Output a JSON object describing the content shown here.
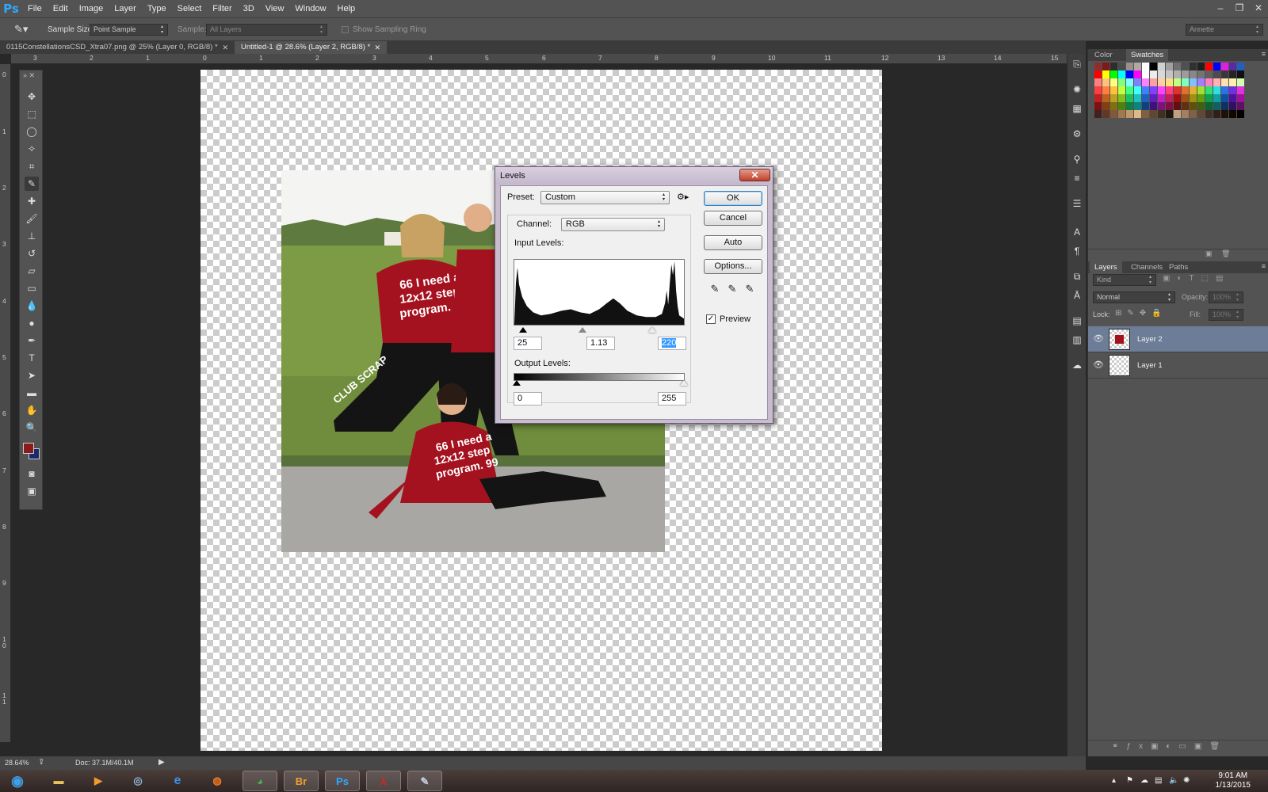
{
  "menubar": {
    "logo": "Ps",
    "items": [
      "File",
      "Edit",
      "Image",
      "Layer",
      "Type",
      "Select",
      "Filter",
      "3D",
      "View",
      "Window",
      "Help"
    ],
    "window_controls": [
      "–",
      "❐",
      "✕"
    ]
  },
  "options": {
    "sample_size_label": "Sample Size:",
    "sample_size_value": "Point Sample",
    "sample_label": "Sample:",
    "sample_value": "All Layers",
    "sampling_ring_label": "Show Sampling Ring",
    "workspace": "Annette"
  },
  "tabs": [
    {
      "title": "0115ConstellationsCSD_Xtra07.png @ 25% (Layer 0, RGB/8) *",
      "active": false
    },
    {
      "title": "Untitled-1 @ 28.6% (Layer 2, RGB/8) *",
      "active": true
    }
  ],
  "ruler": {
    "top_labels": [
      "3",
      "2",
      "1",
      "0",
      "1",
      "2",
      "3",
      "4",
      "5",
      "6",
      "7",
      "8",
      "9",
      "10",
      "11",
      "12",
      "13",
      "14",
      "15"
    ],
    "left_labels": [
      "0",
      "1",
      "2",
      "3",
      "4",
      "5",
      "6",
      "7",
      "8",
      "9",
      "1 0",
      "1 1"
    ]
  },
  "status": {
    "zoom": "28.64%",
    "doc": "Doc: 37.1M/40.1M"
  },
  "panels": {
    "top_tabs": [
      "Color",
      "Swatches"
    ],
    "layers_tabs": [
      "Layers",
      "Channels",
      "Paths"
    ],
    "kind_filter": "Kind",
    "blend_mode": "Normal",
    "opacity_label": "Opacity:",
    "opacity_value": "100%",
    "lock_label": "Lock:",
    "fill_label": "Fill:",
    "fill_value": "100%",
    "layers": [
      {
        "name": "Layer 2",
        "selected": true
      },
      {
        "name": "Layer 1",
        "selected": false
      }
    ]
  },
  "levels": {
    "title": "Levels",
    "preset_label": "Preset:",
    "preset_value": "Custom",
    "channel_label": "Channel:",
    "channel_value": "RGB",
    "input_levels_label": "Input Levels:",
    "output_levels_label": "Output Levels:",
    "input_black": "25",
    "input_gamma": "1.13",
    "input_white": "220",
    "output_black": "0",
    "output_white": "255",
    "ok": "OK",
    "cancel": "Cancel",
    "auto": "Auto",
    "options": "Options...",
    "preview_label": "Preview",
    "preview_checked": true
  },
  "photo": {
    "shirt_text_1": "66 I need a 12x12 step program. 99",
    "shirt_text_2": "66 I need a 12x12 step program. 99",
    "pants_text": "CLUB SCRAP"
  },
  "taskbar": {
    "time": "9:01 AM",
    "date": "1/13/2015",
    "apps": [
      "Br",
      "Ps"
    ]
  },
  "colors": {
    "foreground": "#8b1a1a",
    "background": "#1a2a6b",
    "dialog_frame": "#c8bdcf",
    "selected_layer": "#6e7d97"
  }
}
